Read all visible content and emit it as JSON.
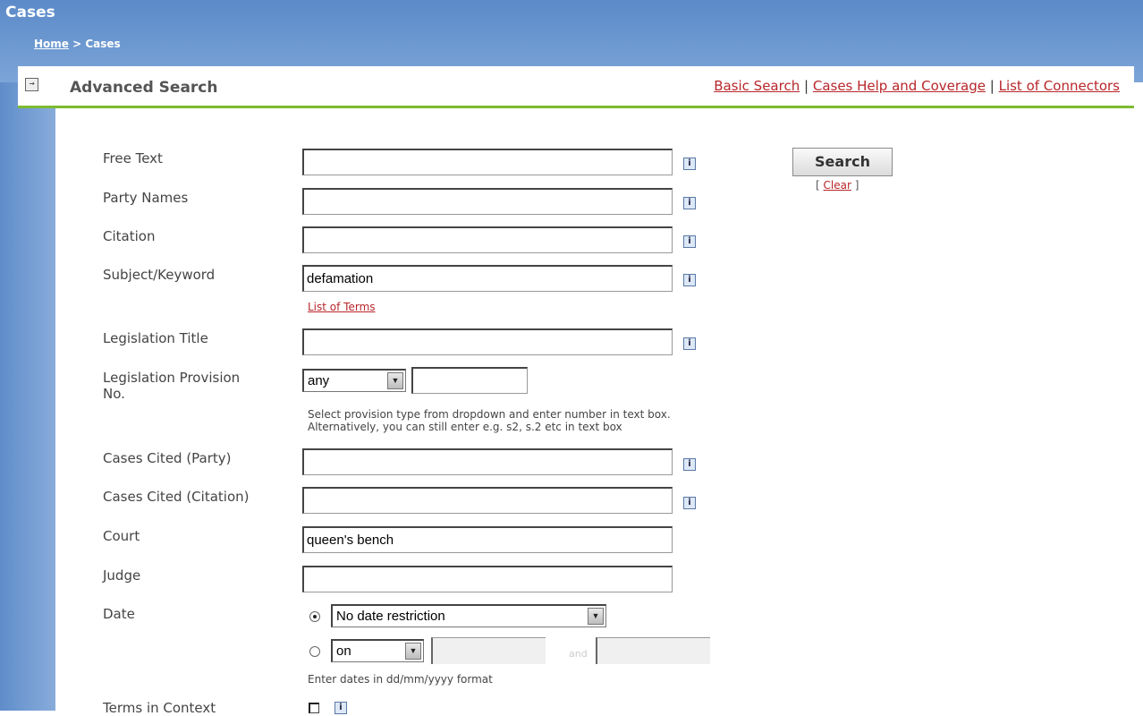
{
  "app": {
    "title": "Cases"
  },
  "breadcrumb": {
    "home": "Home",
    "separator": ">",
    "current": "Cases"
  },
  "panel": {
    "title": "Advanced Search",
    "links": {
      "basic_search": "Basic Search",
      "help": "Cases Help and Coverage",
      "connectors": "List of Connectors",
      "separator": "|"
    }
  },
  "form": {
    "free_text": {
      "label": "Free Text",
      "value": ""
    },
    "party_names": {
      "label": "Party Names",
      "value": ""
    },
    "citation": {
      "label": "Citation",
      "value": ""
    },
    "subject_keyword": {
      "label": "Subject/Keyword",
      "value": "defamation",
      "link": "List of Terms"
    },
    "legislation_title": {
      "label": "Legislation Title",
      "value": ""
    },
    "legislation_provision": {
      "label_line1": "Legislation Provision",
      "label_line2": "No.",
      "select_value": "any",
      "value": "",
      "hint_line1": "Select provision type from dropdown and enter number in text box.",
      "hint_line2": "Alternatively, you can still enter e.g. s2, s.2 etc in text box"
    },
    "cases_cited_party": {
      "label": "Cases Cited (Party)",
      "value": ""
    },
    "cases_cited_citation": {
      "label": "Cases Cited (Citation)",
      "value": ""
    },
    "court": {
      "label": "Court",
      "value": "queen's bench"
    },
    "judge": {
      "label": "Judge",
      "value": ""
    },
    "date": {
      "label": "Date",
      "option1_value": "No date restriction",
      "option2_select": "on",
      "and_label": "and",
      "hint": "Enter dates in dd/mm/yyyy format"
    },
    "terms_in_context": {
      "label": "Terms in Context"
    }
  },
  "actions": {
    "search": "Search",
    "clear": "Clear",
    "clear_open": "[",
    "clear_close": "]"
  },
  "icons": {
    "info": "i",
    "expand": "→",
    "dropdown": "▼"
  }
}
